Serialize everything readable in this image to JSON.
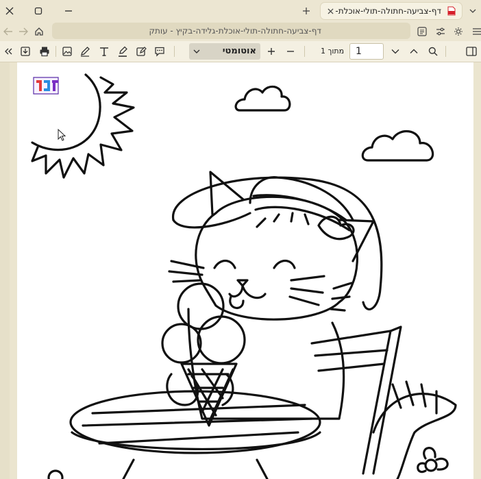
{
  "tab": {
    "title": "דף-צביעה-חתולה-תולי-אוכלת-",
    "favicon": "pdf-file-icon"
  },
  "window": {
    "icons": [
      "close-icon",
      "maximize-icon",
      "minimize-icon",
      "tab-list-icon",
      "new-tab-icon"
    ]
  },
  "nav": {
    "url_text": "דף-צביעה-חתולה-תולי-אוכלת-גלידה-בקיץ - עותק",
    "icons": [
      "back-arrow-icon",
      "forward-arrow-icon",
      "home-icon",
      "reader-view-icon",
      "settings-sliders-icon",
      "brightness-icon"
    ]
  },
  "pdf_toolbar": {
    "zoom_value": "אוטומטי",
    "page_number": "1",
    "page_of": "מתוך 1",
    "icons": [
      "expand-sidebar-icon",
      "save-download-icon",
      "print-icon",
      "add-image-icon",
      "draw-pen-icon",
      "text-tool-icon",
      "highlight-icon",
      "signature-icon",
      "comment-icon",
      "zoom-in-plus-icon",
      "zoom-out-minus-icon",
      "page-down-icon",
      "page-up-icon",
      "search-icon",
      "sidebar-toggle-icon"
    ]
  },
  "document": {
    "logo_text": "דפי",
    "illustration": "coloring page: cat with sun hat eating ice cream cone at table, sun, clouds, flower"
  },
  "colors": {
    "chrome_bg": "#ece6d2",
    "toolbar_bg": "#f4f0e2",
    "url_bg": "#e0d9c0",
    "pdf_icon_red": "#d6202a"
  }
}
